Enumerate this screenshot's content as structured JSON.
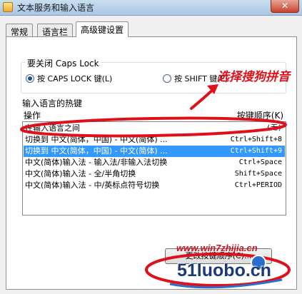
{
  "window": {
    "title": "文本服务和输入语言",
    "close_label": "✕"
  },
  "tabs": [
    {
      "label": "常规",
      "active": false
    },
    {
      "label": "语言栏",
      "active": false
    },
    {
      "label": "高级键设置",
      "active": true
    }
  ],
  "caps_lock": {
    "legend": "要关闭 Caps Lock",
    "options": [
      {
        "label": "按 CAPS LOCK 键(L)",
        "checked": true
      },
      {
        "label": "按 SHIFT 键(F)",
        "checked": false
      }
    ]
  },
  "hotkeys": {
    "legend": "输入语言的热键",
    "col_action": "操作",
    "col_keys": "按键顺序(K)",
    "rows": [
      {
        "action": "在输入语言之间",
        "keys": "(无)",
        "selected": false
      },
      {
        "action": "切换到 中文(简体，中国) - 中文(简体) ...",
        "keys": "Ctrl+Shift+8",
        "selected": false
      },
      {
        "action": "切换到 中文(简体，中国) - 中文(简体) ...",
        "keys": "Ctrl+Shift+9",
        "selected": true
      },
      {
        "action": "中文(简体)输入法 - 输入法/非输入法切换",
        "keys": "Ctrl+Space",
        "selected": false
      },
      {
        "action": "中文(简体)输入法 - 全/半角切换",
        "keys": "Shift+Space",
        "selected": false
      },
      {
        "action": "中文(简体)输入法 - 中/英标点符号切换",
        "keys": "Ctrl+PERIOD",
        "selected": false
      }
    ],
    "change_button": "更改按键顺序(C)..."
  },
  "annotation": {
    "text": "选择搜狗拼音",
    "color": "#e0101a"
  },
  "watermark": {
    "url": "www.win7zhijia.cn",
    "logo_text": "51luobo.cn"
  },
  "colors": {
    "selection": "#3399ff",
    "annotation": "#e0101a"
  }
}
